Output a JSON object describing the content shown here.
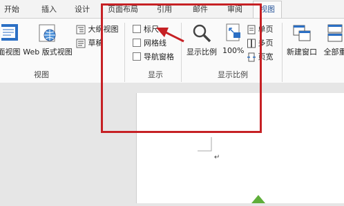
{
  "tabs": [
    {
      "label": "开始",
      "active": false
    },
    {
      "label": "插入",
      "active": false
    },
    {
      "label": "设计",
      "active": false
    },
    {
      "label": "页面布局",
      "active": false
    },
    {
      "label": "引用",
      "active": false
    },
    {
      "label": "邮件",
      "active": false
    },
    {
      "label": "审阅",
      "active": false
    },
    {
      "label": "视图",
      "active": true
    }
  ],
  "views_group": {
    "read_mode_label": "面视图",
    "web_layout_label": "Web 版式视图",
    "outline_label": "大纲视图",
    "draft_label": "草稿",
    "group_label": "视图"
  },
  "show_group": {
    "ruler_label": "标尺",
    "ruler_checked": false,
    "gridlines_label": "网格线",
    "gridlines_checked": false,
    "navpane_label": "导航窗格",
    "navpane_checked": false,
    "group_label": "显示"
  },
  "zoom_group": {
    "zoom_label": "显示比例",
    "hundred_label": "100%",
    "one_page_label": "单页",
    "multi_page_label": "多页",
    "page_width_label": "页宽",
    "group_label": "显示比例"
  },
  "window_group": {
    "new_window_label": "新建窗口",
    "arrange_all_label": "全部重"
  },
  "document": {
    "paragraph_mark": "↵"
  },
  "colors": {
    "annotation_red": "#c62024",
    "accent_blue": "#2b579a"
  }
}
